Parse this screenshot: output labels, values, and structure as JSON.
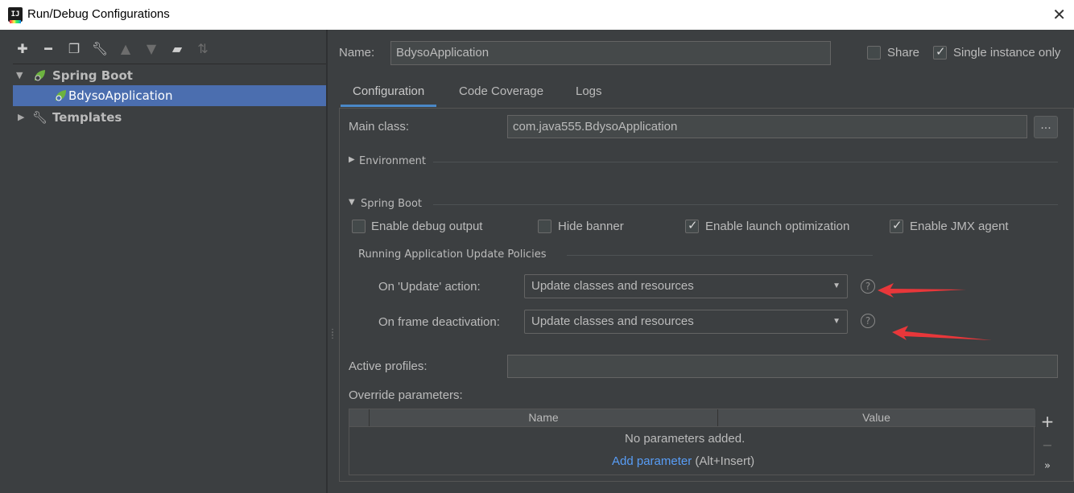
{
  "window": {
    "title": "Run/Debug Configurations",
    "icon": "intellij-icon",
    "app_icon_text": "IJ"
  },
  "toolbar": [
    "add-icon",
    "remove-icon",
    "copy-icon",
    "wrench-icon",
    "move-up-icon",
    "move-down-icon",
    "new-folder-icon",
    "sort-icon"
  ],
  "tree": {
    "group": "Spring Boot",
    "item": "BdysoApplication",
    "templates": "Templates"
  },
  "header": {
    "name_label": "Name:",
    "name_value": "BdysoApplication",
    "share_label": "Share",
    "share_checked": false,
    "single_instance_label": "Single instance only",
    "single_instance_checked": true
  },
  "tabs": [
    "Configuration",
    "Code Coverage",
    "Logs"
  ],
  "config": {
    "main_class_label": "Main class:",
    "main_class_value": "com.java555.BdysoApplication",
    "browse_label": "...",
    "environment_label": "Environment",
    "spring_boot_label": "Spring Boot",
    "options": [
      {
        "label": "Enable debug output",
        "checked": false
      },
      {
        "label": "Hide banner",
        "checked": false
      },
      {
        "label": "Enable launch optimization",
        "checked": true
      },
      {
        "label": "Enable JMX agent",
        "checked": true
      }
    ],
    "policies_label": "Running Application Update Policies",
    "update_action_label": "On 'Update' action:",
    "update_action_value": "Update classes and resources",
    "frame_deactivation_label": "On frame deactivation:",
    "frame_deactivation_value": "Update classes and resources",
    "help_glyph": "?",
    "active_profiles_label": "Active profiles:",
    "active_profiles_value": "",
    "override_label": "Override parameters:",
    "table": {
      "columns": [
        "Name",
        "Value"
      ],
      "empty_text": "No parameters added.",
      "add_link": "Add parameter",
      "add_hint": "(Alt+Insert)"
    }
  },
  "annotation_color": "#e8373a"
}
